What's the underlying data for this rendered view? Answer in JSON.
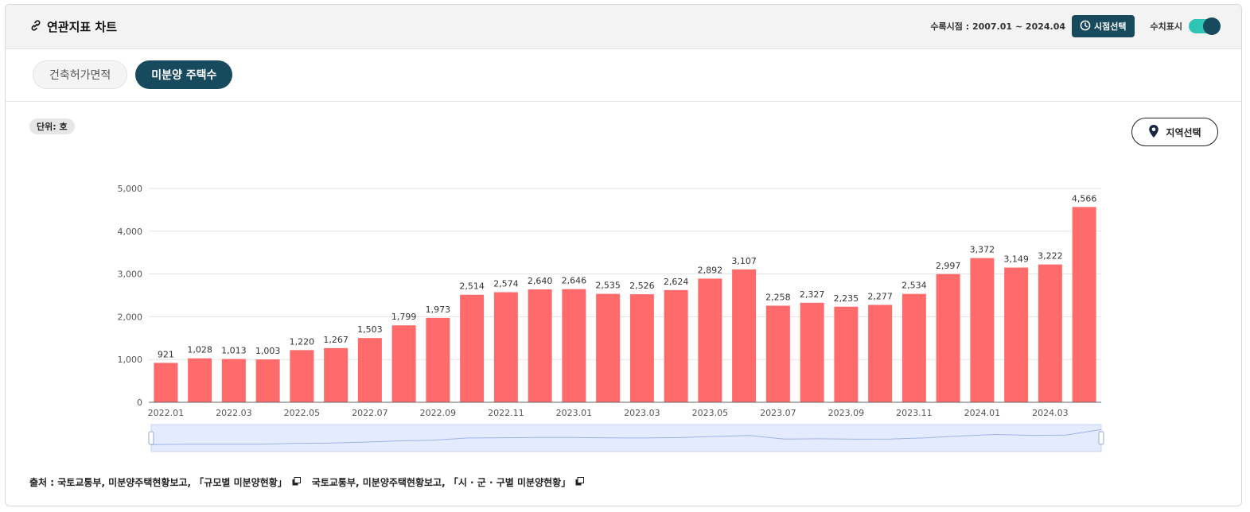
{
  "header": {
    "title": "연관지표 차트",
    "period_text": "수록시점 : 2007.01 ~ 2024.04",
    "period_button": "시점선택",
    "toggle_label": "수치표시",
    "toggle_on": true
  },
  "tabs": [
    {
      "label": "건축허가면적",
      "active": false
    },
    {
      "label": "미분양 주택수",
      "active": true
    }
  ],
  "unit_label": "단위: 호",
  "region_button": "지역선택",
  "icons": {
    "title_icon": "link-icon",
    "period_icon": "clock-icon",
    "region_icon": "map-pin-icon",
    "source_icon": "external-link-icon"
  },
  "colors": {
    "bar": "#ff6b6b",
    "accent": "#174a5c",
    "toggle_track": "#2ec4b6",
    "slider_fill": "#e4ebff"
  },
  "chart_data": {
    "type": "bar",
    "categories": [
      "2022.01",
      "2022.02",
      "2022.03",
      "2022.04",
      "2022.05",
      "2022.06",
      "2022.07",
      "2022.08",
      "2022.09",
      "2022.10",
      "2022.11",
      "2022.12",
      "2023.01",
      "2023.02",
      "2023.03",
      "2023.04",
      "2023.05",
      "2023.06",
      "2023.07",
      "2023.08",
      "2023.09",
      "2023.10",
      "2023.11",
      "2023.12",
      "2024.01",
      "2024.02",
      "2024.03",
      "2024.04"
    ],
    "values": [
      921,
      1028,
      1013,
      1003,
      1220,
      1267,
      1503,
      1799,
      1973,
      2514,
      2574,
      2640,
      2646,
      2535,
      2526,
      2624,
      2892,
      3107,
      2258,
      2327,
      2235,
      2277,
      2534,
      2997,
      3372,
      3149,
      3222,
      4566
    ],
    "value_labels": [
      "921",
      "1,028",
      "1,013",
      "1,003",
      "1,220",
      "1,267",
      "1,503",
      "1,799",
      "1,973",
      "2,514",
      "2,574",
      "2,640",
      "2,646",
      "2,535",
      "2,526",
      "2,624",
      "2,892",
      "3,107",
      "2,258",
      "2,327",
      "2,235",
      "2,277",
      "2,534",
      "2,997",
      "3,372",
      "3,149",
      "3,222",
      "4,566"
    ],
    "x_tick_labels": [
      "2022.01",
      "2022.03",
      "2022.05",
      "2022.07",
      "2022.09",
      "2022.11",
      "2023.01",
      "2023.03",
      "2023.05",
      "2023.07",
      "2023.09",
      "2023.11",
      "2024.01",
      "2024.03"
    ],
    "y_ticks": [
      0,
      1000,
      2000,
      3000,
      4000,
      5000
    ],
    "y_tick_labels": [
      "0",
      "1,000",
      "2,000",
      "3,000",
      "4,000",
      "5,000"
    ],
    "ylim": [
      0,
      5000
    ],
    "grid": true,
    "legend": "none",
    "title": "",
    "xlabel": "",
    "ylabel": ""
  },
  "source": {
    "prefix": "출처 :",
    "items": [
      "국토교통부, 미분양주택현황보고, 「규모별 미분양현황」",
      "국토교통부, 미분양주택현황보고, 「시 · 군 · 구별 미분양현황」"
    ]
  }
}
